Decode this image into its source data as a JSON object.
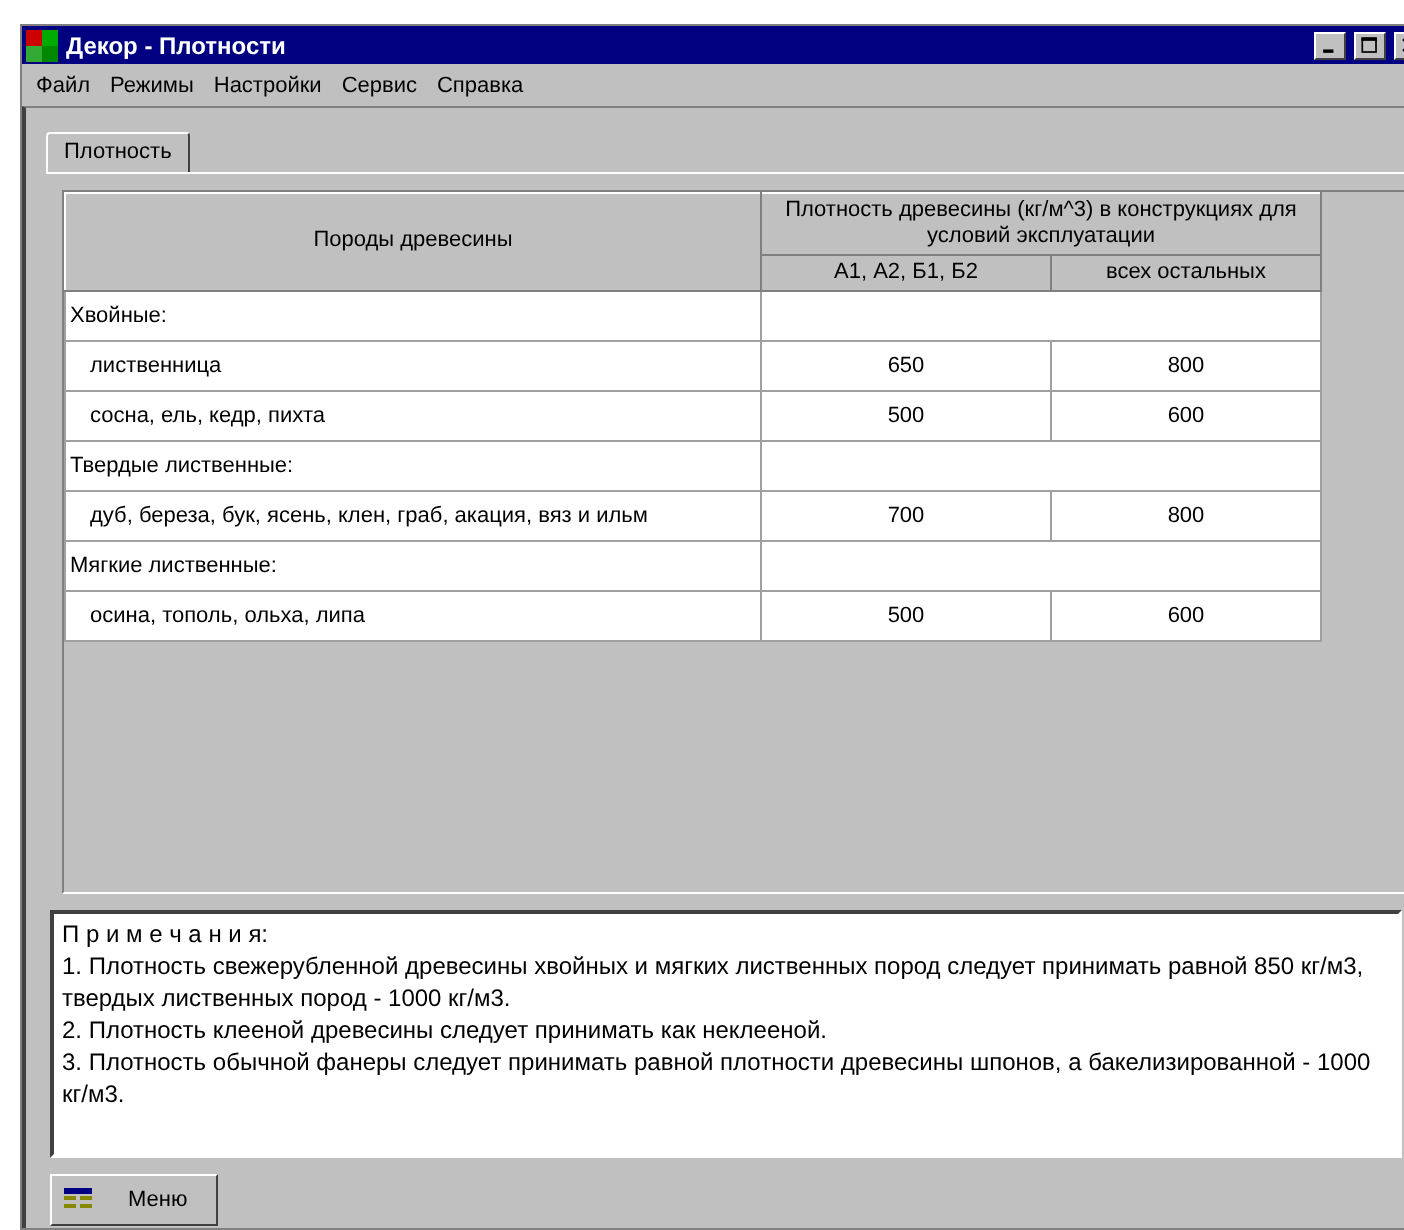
{
  "window": {
    "title": "Декор - Плотности"
  },
  "menu": [
    "Файл",
    "Режимы",
    "Настройки",
    "Сервис",
    "Справка"
  ],
  "tabs": [
    {
      "label": "Плотность",
      "selected": true
    }
  ],
  "table": {
    "columns": [
      "Породы древесины",
      "А1, А2, Б1, Б2",
      "всех остальных"
    ],
    "group_header": "Плотность древесины (кг/м^3) в конструкциях для условий эксплуатации",
    "rows": [
      {
        "kind": "group",
        "label": "Хвойные:"
      },
      {
        "kind": "item",
        "label": "лиственница",
        "values": [
          "650",
          "800"
        ]
      },
      {
        "kind": "item",
        "label": "сосна, ель, кедр, пихта",
        "values": [
          "500",
          "600"
        ]
      },
      {
        "kind": "group",
        "label": "Твердые лиственные:"
      },
      {
        "kind": "item",
        "label": "дуб, береза, бук, ясень, клен, граб, акация, вяз и ильм",
        "values": [
          "700",
          "800"
        ]
      },
      {
        "kind": "group",
        "label": "Мягкие лиственные:"
      },
      {
        "kind": "item",
        "label": "осина, тополь, ольха, липа",
        "values": [
          "500",
          "600"
        ]
      }
    ]
  },
  "notes": {
    "title": "П р и м е ч а н и я:",
    "items": [
      " 1. Плотность свежерубленной древесины хвойных и мягких лиственных пород следует принимать равной 850 кг/м3, твердых лиственных пород - 1000 кг/м3.",
      "2. Плотность клееной древесины следует принимать как неклееной.",
      "3. Плотность обычной фанеры следует принимать равной плотности древесины шпонов, а бакелизированной - 1000 кг/м3."
    ]
  },
  "taskbar": {
    "button": "Меню"
  }
}
